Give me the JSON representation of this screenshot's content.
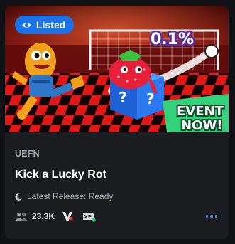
{
  "badge": {
    "label": "Listed",
    "icon": "eye-icon",
    "color": "#1a73e8"
  },
  "thumbnail": {
    "percent_label": "0.1%",
    "event_label_line1": "EVENT",
    "event_label_line2": "NOW!",
    "event_color": "#33d17a"
  },
  "card": {
    "platform": "UEFN",
    "title": "Kick a Lucky Rot",
    "release_status": "Latest Release: Ready",
    "release_icon": "moon-icon",
    "player_count": "23.3K",
    "player_icon": "people-icon",
    "rating_icon": "v-tag-icon",
    "xp_icon": "xp-icon",
    "more_icon": "more-dots-icon"
  }
}
